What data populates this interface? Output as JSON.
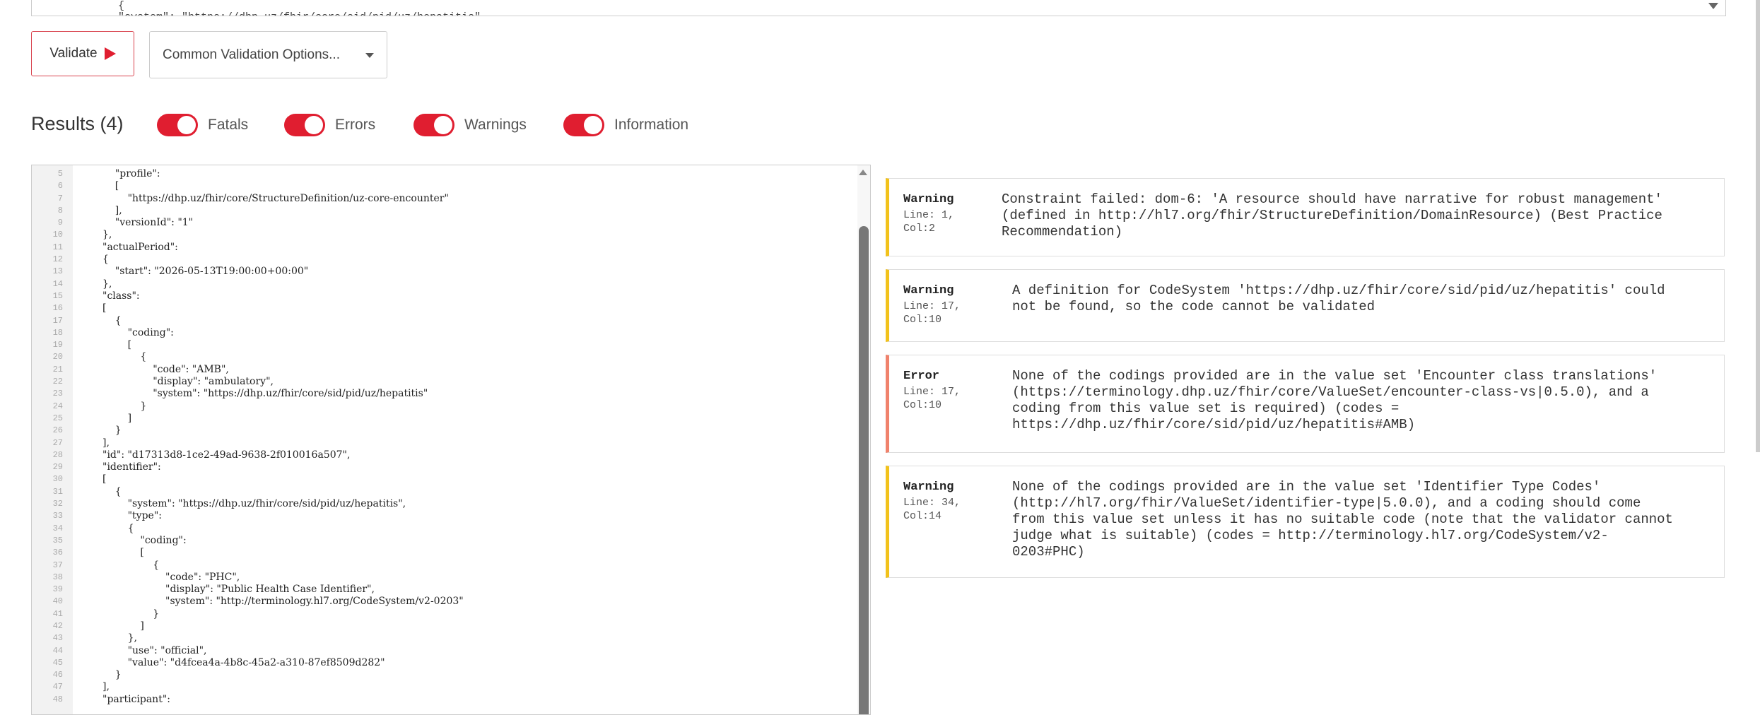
{
  "top_editor": {
    "line_a": "{",
    "line_b": "\"system\": \"https://dhp.uz/fhir/core/sid/pid/uz/hepatitis\""
  },
  "toolbar": {
    "validate_label": "Validate",
    "options_label": "Common Validation Options..."
  },
  "results": {
    "title": "Results (4)",
    "filters": [
      {
        "label": "Fatals",
        "on": true
      },
      {
        "label": "Errors",
        "on": true
      },
      {
        "label": "Warnings",
        "on": true
      },
      {
        "label": "Information",
        "on": true
      }
    ]
  },
  "colors": {
    "accent": "#e01e30",
    "warning": "#f2c21b",
    "error": "#f0826c"
  },
  "code_lines": [
    {
      "n": "5",
      "t": "    \"profile\":"
    },
    {
      "n": "6",
      "t": "    ["
    },
    {
      "n": "7",
      "t": "        \"https://dhp.uz/fhir/core/StructureDefinition/uz-core-encounter\""
    },
    {
      "n": "8",
      "t": "    ],"
    },
    {
      "n": "9",
      "t": "    \"versionId\": \"1\""
    },
    {
      "n": "10",
      "t": "},"
    },
    {
      "n": "11",
      "t": "\"actualPeriod\":"
    },
    {
      "n": "12",
      "t": "{"
    },
    {
      "n": "13",
      "t": "    \"start\": \"2026-05-13T19:00:00+00:00\""
    },
    {
      "n": "14",
      "t": "},"
    },
    {
      "n": "15",
      "t": "\"class\":"
    },
    {
      "n": "16",
      "t": "["
    },
    {
      "n": "17",
      "t": "    {"
    },
    {
      "n": "18",
      "t": "        \"coding\":"
    },
    {
      "n": "19",
      "t": "        ["
    },
    {
      "n": "20",
      "t": "            {"
    },
    {
      "n": "21",
      "t": "                \"code\": \"AMB\","
    },
    {
      "n": "22",
      "t": "                \"display\": \"ambulatory\","
    },
    {
      "n": "23",
      "t": "                \"system\": \"https://dhp.uz/fhir/core/sid/pid/uz/hepatitis\""
    },
    {
      "n": "24",
      "t": "            }"
    },
    {
      "n": "25",
      "t": "        ]"
    },
    {
      "n": "26",
      "t": "    }"
    },
    {
      "n": "27",
      "t": "],"
    },
    {
      "n": "28",
      "t": "\"id\": \"d17313d8-1ce2-49ad-9638-2f010016a507\","
    },
    {
      "n": "29",
      "t": "\"identifier\":"
    },
    {
      "n": "30",
      "t": "["
    },
    {
      "n": "31",
      "t": "    {"
    },
    {
      "n": "32",
      "t": "        \"system\": \"https://dhp.uz/fhir/core/sid/pid/uz/hepatitis\","
    },
    {
      "n": "33",
      "t": "        \"type\":"
    },
    {
      "n": "34",
      "t": "        {"
    },
    {
      "n": "35",
      "t": "            \"coding\":"
    },
    {
      "n": "36",
      "t": "            ["
    },
    {
      "n": "37",
      "t": "                {"
    },
    {
      "n": "38",
      "t": "                    \"code\": \"PHC\","
    },
    {
      "n": "39",
      "t": "                    \"display\": \"Public Health Case Identifier\","
    },
    {
      "n": "40",
      "t": "                    \"system\": \"http://terminology.hl7.org/CodeSystem/v2-0203\""
    },
    {
      "n": "41",
      "t": "                }"
    },
    {
      "n": "42",
      "t": "            ]"
    },
    {
      "n": "43",
      "t": "        },"
    },
    {
      "n": "44",
      "t": "        \"use\": \"official\","
    },
    {
      "n": "45",
      "t": "        \"value\": \"d4fcea4a-4b8c-45a2-a310-87ef8509d282\""
    },
    {
      "n": "46",
      "t": "    }"
    },
    {
      "n": "47",
      "t": "],"
    },
    {
      "n": "48",
      "t": "\"participant\":"
    }
  ],
  "issues": [
    {
      "level": "Warning",
      "line": "Line: 1,",
      "col": "Col:2",
      "message": "Constraint failed: dom-6: 'A resource should have narrative for robust management'\n(defined in http://hl7.org/fhir/StructureDefinition/DomainResource) (Best Practice\nRecommendation)"
    },
    {
      "level": "Warning",
      "line": "Line: 17,",
      "col": "Col:10",
      "message": "A definition for CodeSystem 'https://dhp.uz/fhir/core/sid/pid/uz/hepatitis' could\nnot be found, so the code cannot be validated"
    },
    {
      "level": "Error",
      "line": "Line: 17,",
      "col": "Col:10",
      "message": "None of the codings provided are in the value set 'Encounter class translations'\n(https://terminology.dhp.uz/fhir/core/ValueSet/encounter-class-vs|0.5.0), and a\ncoding from this value set is required) (codes =\nhttps://dhp.uz/fhir/core/sid/pid/uz/hepatitis#AMB)"
    },
    {
      "level": "Warning",
      "line": "Line: 34,",
      "col": "Col:14",
      "message": "None of the codings provided are in the value set 'Identifier Type Codes'\n(http://hl7.org/fhir/ValueSet/identifier-type|5.0.0), and a coding should come\nfrom this value set unless it has no suitable code (note that the validator cannot\njudge what is suitable) (codes = http://terminology.hl7.org/CodeSystem/v2-\n0203#PHC)"
    }
  ]
}
